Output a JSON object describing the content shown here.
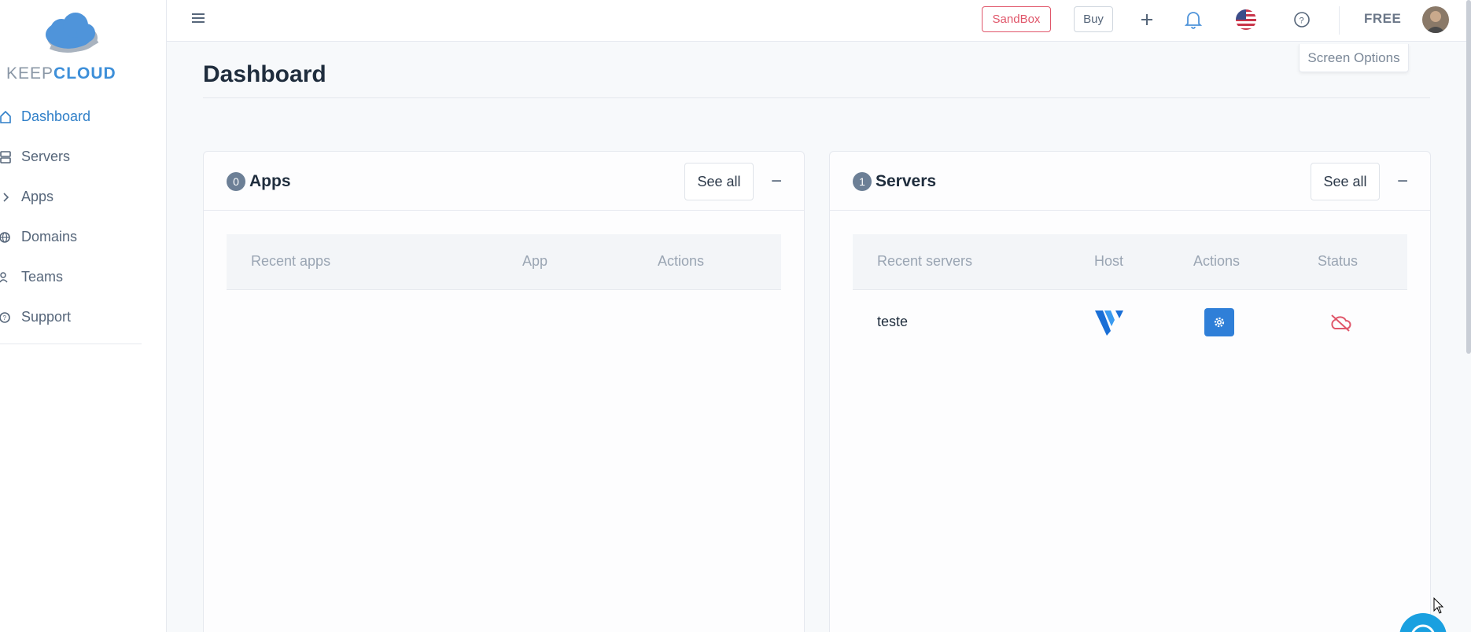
{
  "brand": {
    "keep": "KEEP",
    "cloud": "CLOUD"
  },
  "sidebar": {
    "items": [
      {
        "label": "Dashboard",
        "icon": "home-icon",
        "active": true
      },
      {
        "label": "Servers",
        "icon": "server-icon",
        "active": false
      },
      {
        "label": "Apps",
        "icon": "chevron-right-icon",
        "active": false
      },
      {
        "label": "Domains",
        "icon": "globe-icon",
        "active": false
      },
      {
        "label": "Teams",
        "icon": "users-icon",
        "active": false
      },
      {
        "label": "Support",
        "icon": "help-circle-icon",
        "active": false
      }
    ]
  },
  "topbar": {
    "sandbox_label": "SandBox",
    "buy_label": "Buy",
    "plan_label": "FREE",
    "icons": [
      "menu-icon",
      "plus-icon",
      "bell-icon",
      "us-flag-icon",
      "help-circle-icon",
      "user-avatar"
    ]
  },
  "screen_options_label": "Screen Options",
  "page_title": "Dashboard",
  "apps_card": {
    "count": "0",
    "title": "Apps",
    "see_all_label": "See all",
    "collapse_label": "−",
    "columns": [
      "Recent apps",
      "App",
      "Actions"
    ],
    "rows": []
  },
  "servers_card": {
    "count": "1",
    "title": "Servers",
    "see_all_label": "See all",
    "collapse_label": "−",
    "columns": [
      "Recent servers",
      "Host",
      "Actions",
      "Status"
    ],
    "rows": [
      {
        "name": "teste",
        "host_icon": "vultr-logo-icon",
        "action_icon": "gear-icon",
        "status_icon": "cloud-off-icon"
      }
    ]
  },
  "colors": {
    "accent": "#2f7fd8",
    "sandbox": "#e0566a",
    "status_offline": "#e0566a",
    "badge": "#6c7f96"
  }
}
